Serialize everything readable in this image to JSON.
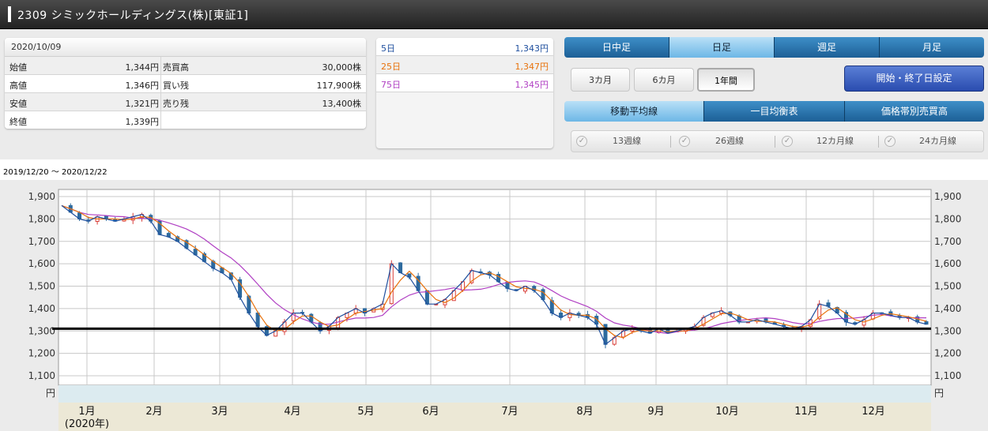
{
  "header": {
    "title": "2309 シミックホールディングス(株)[東証1]"
  },
  "quote": {
    "date": "2020/10/09",
    "rows": [
      {
        "label": "始値",
        "value": "1,344円",
        "label2": "売買高",
        "value2": "30,000株"
      },
      {
        "label": "高値",
        "value": "1,346円",
        "label2": "買い残",
        "value2": "117,900株"
      },
      {
        "label": "安値",
        "value": "1,321円",
        "label2": "売り残",
        "value2": "13,400株"
      },
      {
        "label": "終値",
        "value": "1,339円",
        "label2": "",
        "value2": ""
      }
    ]
  },
  "ma_panel": {
    "rows": [
      {
        "label": "5日",
        "value": "1,343円",
        "color": "#1f4f9e"
      },
      {
        "label": "25日",
        "value": "1,347円",
        "color": "#e8720c"
      },
      {
        "label": "75日",
        "value": "1,345円",
        "color": "#b03fc3"
      }
    ]
  },
  "tabs": {
    "items": [
      "日中足",
      "日足",
      "週足",
      "月足"
    ],
    "active": "日足"
  },
  "periods": {
    "items": [
      "3カ月",
      "6カ月",
      "1年間"
    ],
    "active": "1年間"
  },
  "date_setting_button": "開始・終了日設定",
  "tabs2": {
    "items": [
      "移動平均線",
      "一目均衡表",
      "価格帯別売買高"
    ],
    "active": "移動平均線"
  },
  "ma_options": {
    "items": [
      "13週線",
      "26週線",
      "12カ月線",
      "24カ月線"
    ]
  },
  "range": "2019/12/20 〜 2020/12/22",
  "chart_data": {
    "type": "candlestick",
    "x_range": [
      "2019/12/20",
      "2020/12/22"
    ],
    "y_ticks": [
      "1,900",
      "1,800",
      "1,700",
      "1,600",
      "1,500",
      "1,400",
      "1,300",
      "1,200",
      "1,100"
    ],
    "ylim": [
      1100,
      1900
    ],
    "y_unit": "円",
    "months": [
      "1月",
      "2月",
      "3月",
      "4月",
      "5月",
      "6月",
      "7月",
      "8月",
      "9月",
      "10月",
      "11月",
      "12月"
    ],
    "year_label": "(2020年)",
    "horizontal_line": 1310,
    "close_series": [
      [
        0,
        1860
      ],
      [
        10,
        1830
      ],
      [
        20,
        1800
      ],
      [
        30,
        1790
      ],
      [
        40,
        1810
      ],
      [
        50,
        1800
      ],
      [
        60,
        1790
      ],
      [
        70,
        1800
      ],
      [
        80,
        1810
      ],
      [
        90,
        1820
      ],
      [
        100,
        1790
      ],
      [
        110,
        1730
      ],
      [
        120,
        1720
      ],
      [
        130,
        1700
      ],
      [
        140,
        1670
      ],
      [
        150,
        1640
      ],
      [
        160,
        1610
      ],
      [
        170,
        1580
      ],
      [
        180,
        1560
      ],
      [
        190,
        1530
      ],
      [
        200,
        1450
      ],
      [
        210,
        1380
      ],
      [
        220,
        1320
      ],
      [
        230,
        1280
      ],
      [
        240,
        1300
      ],
      [
        250,
        1340
      ],
      [
        260,
        1380
      ],
      [
        270,
        1380
      ],
      [
        280,
        1340
      ],
      [
        290,
        1300
      ],
      [
        300,
        1320
      ],
      [
        310,
        1360
      ],
      [
        320,
        1380
      ],
      [
        330,
        1400
      ],
      [
        340,
        1380
      ],
      [
        350,
        1400
      ],
      [
        360,
        1420
      ],
      [
        370,
        1600
      ],
      [
        380,
        1560
      ],
      [
        390,
        1540
      ],
      [
        400,
        1480
      ],
      [
        410,
        1420
      ],
      [
        420,
        1420
      ],
      [
        430,
        1440
      ],
      [
        440,
        1480
      ],
      [
        450,
        1520
      ],
      [
        460,
        1570
      ],
      [
        470,
        1560
      ],
      [
        480,
        1550
      ],
      [
        490,
        1520
      ],
      [
        500,
        1490
      ],
      [
        510,
        1480
      ],
      [
        520,
        1500
      ],
      [
        530,
        1480
      ],
      [
        540,
        1440
      ],
      [
        550,
        1380
      ],
      [
        560,
        1360
      ],
      [
        570,
        1380
      ],
      [
        580,
        1370
      ],
      [
        590,
        1360
      ],
      [
        600,
        1330
      ],
      [
        610,
        1240
      ],
      [
        620,
        1270
      ],
      [
        630,
        1300
      ],
      [
        640,
        1310
      ],
      [
        650,
        1300
      ],
      [
        660,
        1290
      ],
      [
        670,
        1310
      ],
      [
        680,
        1290
      ],
      [
        690,
        1300
      ],
      [
        700,
        1310
      ],
      [
        710,
        1320
      ],
      [
        720,
        1360
      ],
      [
        730,
        1380
      ],
      [
        740,
        1390
      ],
      [
        750,
        1370
      ],
      [
        760,
        1340
      ],
      [
        770,
        1340
      ],
      [
        780,
        1350
      ],
      [
        790,
        1340
      ],
      [
        800,
        1330
      ],
      [
        810,
        1320
      ],
      [
        820,
        1310
      ],
      [
        830,
        1320
      ],
      [
        840,
        1350
      ],
      [
        850,
        1420
      ],
      [
        860,
        1410
      ],
      [
        870,
        1380
      ],
      [
        880,
        1340
      ],
      [
        890,
        1330
      ],
      [
        900,
        1350
      ],
      [
        910,
        1380
      ],
      [
        920,
        1380
      ],
      [
        930,
        1370
      ],
      [
        940,
        1360
      ],
      [
        950,
        1360
      ],
      [
        960,
        1340
      ],
      [
        970,
        1330
      ]
    ],
    "ma5_color": "#1f4f9e",
    "ma25_color": "#e8720c",
    "ma75_color": "#b03fc3",
    "up_color": "#d9403a",
    "down_color": "#2d6a9e"
  }
}
